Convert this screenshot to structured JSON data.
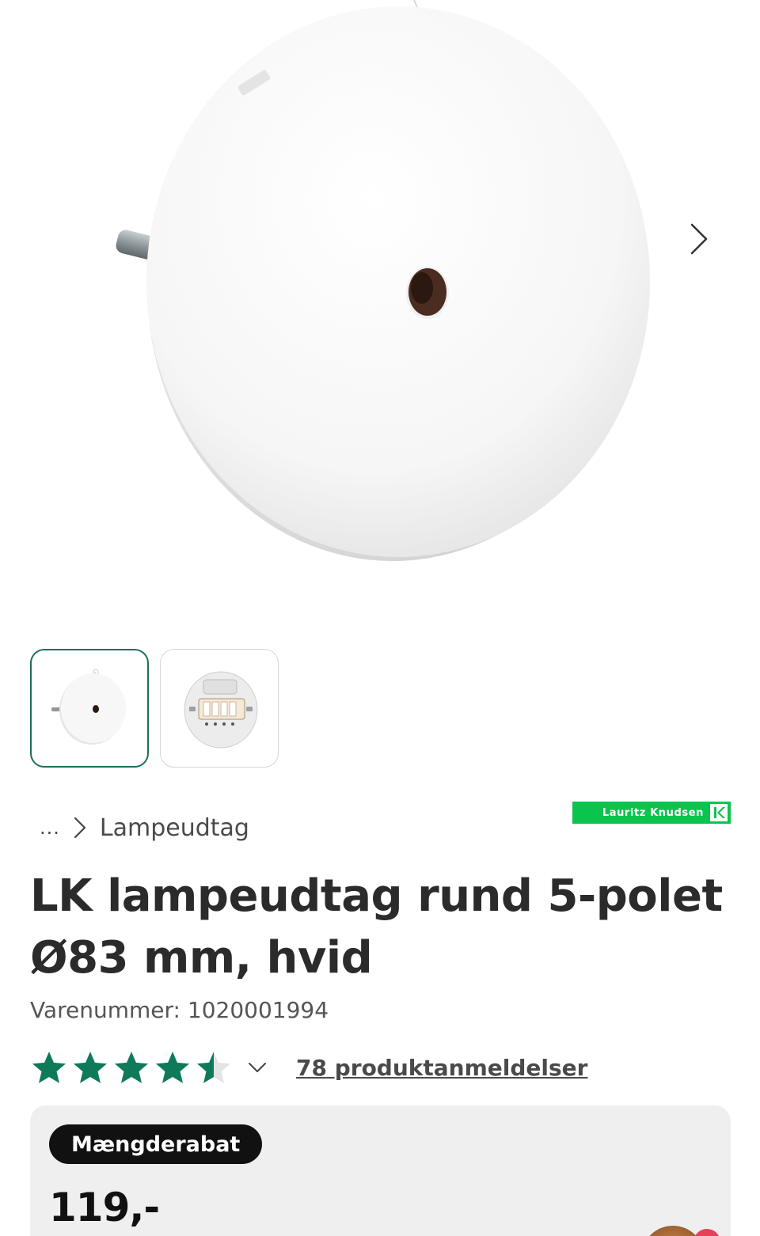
{
  "gallery": {
    "next_icon": "chevron-right-icon",
    "thumbnails": [
      {
        "name": "thumbnail-front",
        "active": true
      },
      {
        "name": "thumbnail-back",
        "active": false
      }
    ]
  },
  "brand": {
    "logo_text": "Lauritz Knudsen",
    "logo_mark": "K",
    "color": "#0bc44e"
  },
  "breadcrumb": {
    "ellipsis": "...",
    "current": "Lampeudtag"
  },
  "product": {
    "title": "LK lampeudtag rund 5-polet Ø83 mm, hvid",
    "sku": "Varenummer: 1020001994"
  },
  "rating": {
    "value": 4.5,
    "max": 5,
    "reviews_label": "78 produktanmeldelser",
    "star_color": "#0f7a5a"
  },
  "pricing": {
    "badge": "Mængderabat",
    "price": "119,-"
  }
}
